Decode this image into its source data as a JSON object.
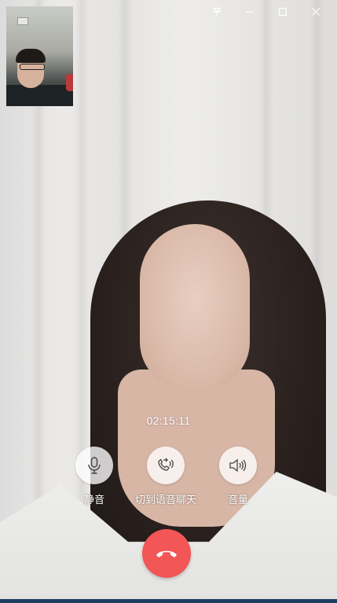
{
  "call": {
    "timer": "02:15:11",
    "controls": {
      "mute_label": "静音",
      "switch_voice_label": "切到语音聊天",
      "volume_label": "音量"
    },
    "hangup_color": "#f25656"
  },
  "window": {
    "buttons": [
      "pin-icon",
      "minimize-icon",
      "maximize-icon",
      "close-icon"
    ]
  },
  "icons": {
    "mute": "microphone-icon",
    "switch_voice": "phone-forward-icon",
    "volume": "speaker-icon",
    "hangup": "phone-hangup-icon"
  }
}
